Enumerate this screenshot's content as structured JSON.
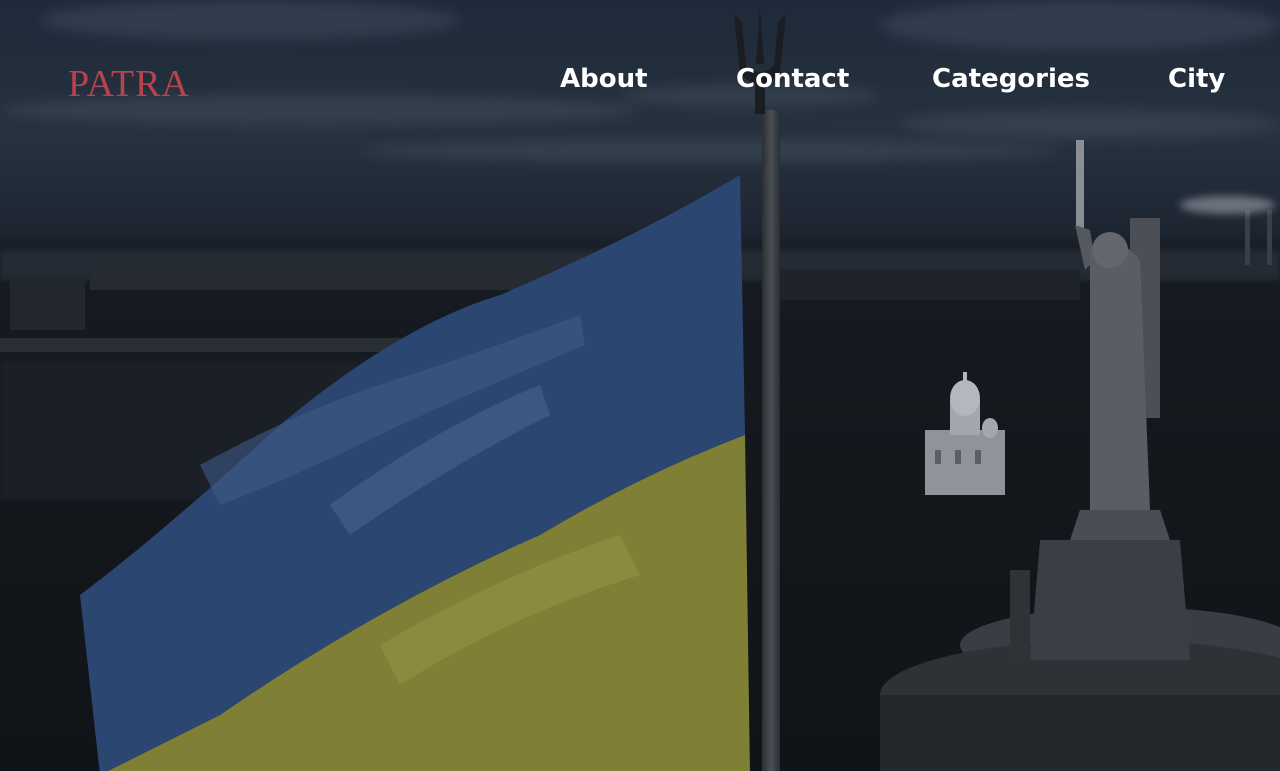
{
  "brand": {
    "logo_text": "PATRA",
    "logo_color": "#b8424d"
  },
  "nav": {
    "items": [
      {
        "label": "About"
      },
      {
        "label": "Contact"
      },
      {
        "label": "Categories"
      },
      {
        "label": "City"
      }
    ]
  },
  "hero": {
    "image_subject": "ukrainian-flag-over-city-at-dusk",
    "flag_colors": {
      "top": "#2c4a78",
      "bottom": "#8a8a3a"
    }
  }
}
